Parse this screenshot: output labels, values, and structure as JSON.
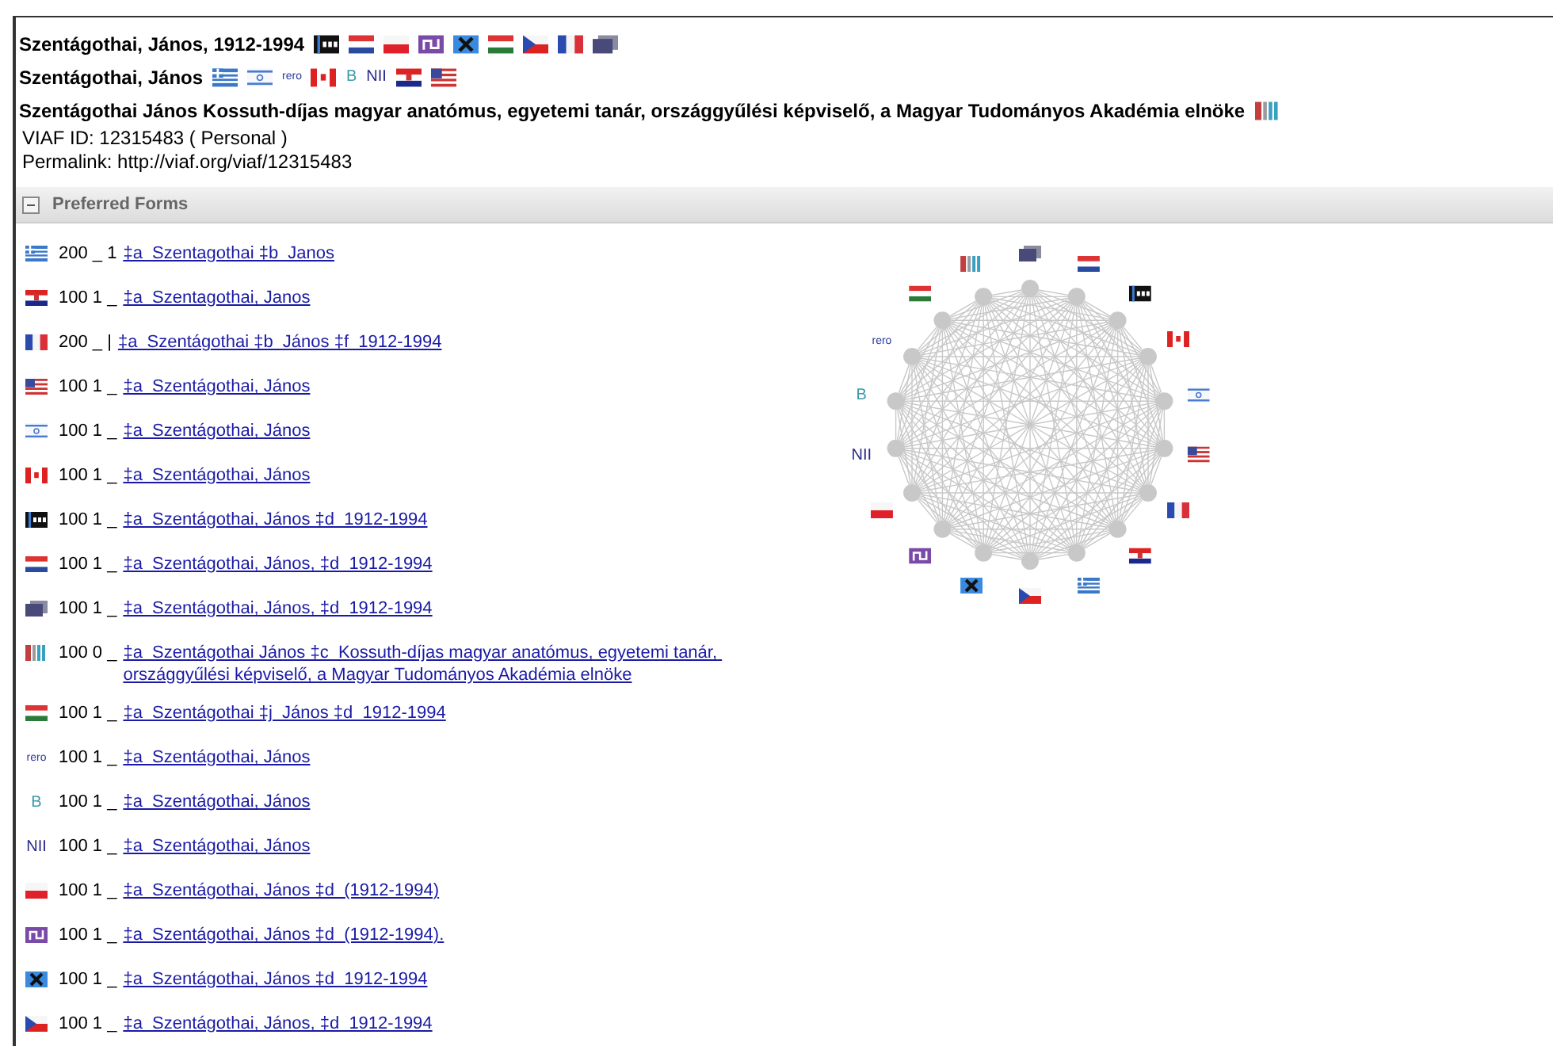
{
  "headings": [
    {
      "text": "Szentágothai, János, 1912-1994",
      "sources": [
        {
          "kind": "dnb"
        },
        {
          "kind": "nl"
        },
        {
          "kind": "pl"
        },
        {
          "kind": "nukat"
        },
        {
          "kind": "x"
        },
        {
          "kind": "hu"
        },
        {
          "kind": "cz"
        },
        {
          "kind": "fr"
        },
        {
          "kind": "stack"
        }
      ]
    },
    {
      "text": "Szentágothai, János",
      "sources": [
        {
          "kind": "gr"
        },
        {
          "kind": "il"
        },
        {
          "kind": "rero",
          "label": "rero"
        },
        {
          "kind": "ca"
        },
        {
          "kind": "b",
          "label": "B"
        },
        {
          "kind": "nii",
          "label": "NII"
        },
        {
          "kind": "hr"
        },
        {
          "kind": "us"
        }
      ]
    },
    {
      "text": "Szentágothai János Kossuth-díjas magyar anatómus, egyetemi tanár, országgyűlési képviselő, a Magyar Tudományos Akadémia elnöke",
      "sources": [
        {
          "kind": "bars"
        }
      ]
    }
  ],
  "viaf_id": "VIAF ID: 12315483 ( Personal )",
  "permalink": "Permalink: http://viaf.org/viaf/12315483",
  "section": {
    "title": "Preferred Forms",
    "expanded": true
  },
  "forms": [
    {
      "source": {
        "kind": "gr"
      },
      "tag": "200 _ 1",
      "heading": "‡a  Szentagothai ‡b  Janos"
    },
    {
      "source": {
        "kind": "hr"
      },
      "tag": "100 1 _",
      "heading": "‡a  Szentagothai, Janos"
    },
    {
      "source": {
        "kind": "fr"
      },
      "tag": "200 _ |",
      "heading": "‡a  Szentágothai ‡b  János ‡f  1912-1994"
    },
    {
      "source": {
        "kind": "us"
      },
      "tag": "100 1 _",
      "heading": "‡a  Szentágothai, János"
    },
    {
      "source": {
        "kind": "il"
      },
      "tag": "100 1 _",
      "heading": "‡a  Szentágothai, János"
    },
    {
      "source": {
        "kind": "ca"
      },
      "tag": "100 1 _",
      "heading": "‡a  Szentágothai, János"
    },
    {
      "source": {
        "kind": "dnb"
      },
      "tag": "100 1 _",
      "heading": "‡a  Szentágothai, János ‡d  1912-1994"
    },
    {
      "source": {
        "kind": "nl"
      },
      "tag": "100 1 _",
      "heading": "‡a  Szentágothai, János, ‡d  1912-1994"
    },
    {
      "source": {
        "kind": "stack"
      },
      "tag": "100 1 _",
      "heading": "‡a  Szentágothai, János, ‡d  1912-1994"
    },
    {
      "source": {
        "kind": "bars"
      },
      "tag": "100 0 _",
      "heading": "‡a  Szentágothai János ‡c  Kossuth-díjas magyar anatómus, egyetemi tanár, országgyűlési képviselő, a Magyar Tudományos Akadémia elnöke"
    },
    {
      "source": {
        "kind": "hu"
      },
      "tag": "100 1 _",
      "heading": "‡a  Szentágothai ‡j  János ‡d  1912-1994"
    },
    {
      "source": {
        "kind": "rero",
        "label": "rero"
      },
      "tag": "100 1 _",
      "heading": "‡a  Szentágothai, János"
    },
    {
      "source": {
        "kind": "b",
        "label": "B"
      },
      "tag": "100 1 _",
      "heading": "‡a  Szentágothai, János"
    },
    {
      "source": {
        "kind": "nii",
        "label": "NII"
      },
      "tag": "100 1 _",
      "heading": "‡a  Szentágothai, János"
    },
    {
      "source": {
        "kind": "pl"
      },
      "tag": "100 1 _",
      "heading": "‡a  Szentágothai, János ‡d  (1912-1994)"
    },
    {
      "source": {
        "kind": "nukat"
      },
      "tag": "100 1 _",
      "heading": "‡a  Szentágothai, János ‡d  (1912-1994)."
    },
    {
      "source": {
        "kind": "x"
      },
      "tag": "100 1 _",
      "heading": "‡a  Szentágothai, János ‡d  1912-1994"
    },
    {
      "source": {
        "kind": "cz"
      },
      "tag": "100 1 _",
      "heading": "‡a  Szentágothai, János, ‡d  1912-1994"
    }
  ],
  "graph": {
    "nodes": [
      {
        "kind": "stack"
      },
      {
        "kind": "nl"
      },
      {
        "kind": "dnb"
      },
      {
        "kind": "ca"
      },
      {
        "kind": "il"
      },
      {
        "kind": "us"
      },
      {
        "kind": "fr"
      },
      {
        "kind": "hr"
      },
      {
        "kind": "gr"
      },
      {
        "kind": "cz"
      },
      {
        "kind": "x"
      },
      {
        "kind": "nukat"
      },
      {
        "kind": "pl"
      },
      {
        "kind": "nii",
        "label": "NII"
      },
      {
        "kind": "b",
        "label": "B"
      },
      {
        "kind": "rero",
        "label": "rero"
      },
      {
        "kind": "hu"
      },
      {
        "kind": "bars"
      }
    ]
  }
}
